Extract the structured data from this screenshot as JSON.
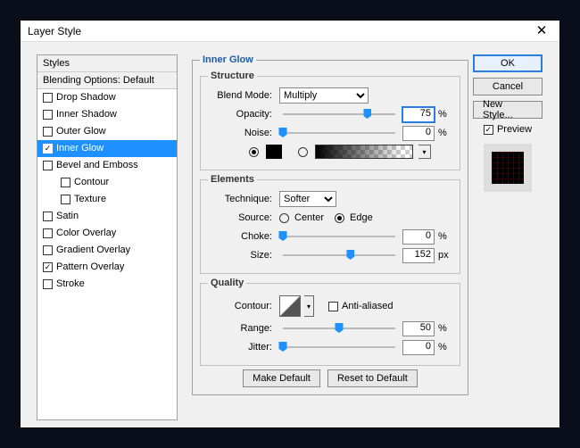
{
  "dialog": {
    "title": "Layer Style"
  },
  "styles": {
    "header": "Styles",
    "blending": "Blending Options: Default",
    "items": [
      {
        "label": "Drop Shadow",
        "checked": false,
        "indent": false
      },
      {
        "label": "Inner Shadow",
        "checked": false,
        "indent": false
      },
      {
        "label": "Outer Glow",
        "checked": false,
        "indent": false
      },
      {
        "label": "Inner Glow",
        "checked": true,
        "indent": false,
        "selected": true
      },
      {
        "label": "Bevel and Emboss",
        "checked": false,
        "indent": false
      },
      {
        "label": "Contour",
        "checked": false,
        "indent": true
      },
      {
        "label": "Texture",
        "checked": false,
        "indent": true
      },
      {
        "label": "Satin",
        "checked": false,
        "indent": false
      },
      {
        "label": "Color Overlay",
        "checked": false,
        "indent": false
      },
      {
        "label": "Gradient Overlay",
        "checked": false,
        "indent": false
      },
      {
        "label": "Pattern Overlay",
        "checked": true,
        "indent": false
      },
      {
        "label": "Stroke",
        "checked": false,
        "indent": false
      }
    ]
  },
  "panel_title": "Inner Glow",
  "structure": {
    "legend": "Structure",
    "blend_mode_label": "Blend Mode:",
    "blend_mode_value": "Multiply",
    "opacity_label": "Opacity:",
    "opacity_value": "75",
    "noise_label": "Noise:",
    "noise_value": "0",
    "pct": "%"
  },
  "elements": {
    "legend": "Elements",
    "technique_label": "Technique:",
    "technique_value": "Softer",
    "source_label": "Source:",
    "center": "Center",
    "edge": "Edge",
    "choke_label": "Choke:",
    "choke_value": "0",
    "size_label": "Size:",
    "size_value": "152",
    "px": "px",
    "pct": "%"
  },
  "quality": {
    "legend": "Quality",
    "contour_label": "Contour:",
    "anti_aliased": "Anti-aliased",
    "range_label": "Range:",
    "range_value": "50",
    "jitter_label": "Jitter:",
    "jitter_value": "0",
    "pct": "%"
  },
  "buttons": {
    "make_default": "Make Default",
    "reset_default": "Reset to Default",
    "ok": "OK",
    "cancel": "Cancel",
    "new_style": "New Style...",
    "preview": "Preview"
  }
}
